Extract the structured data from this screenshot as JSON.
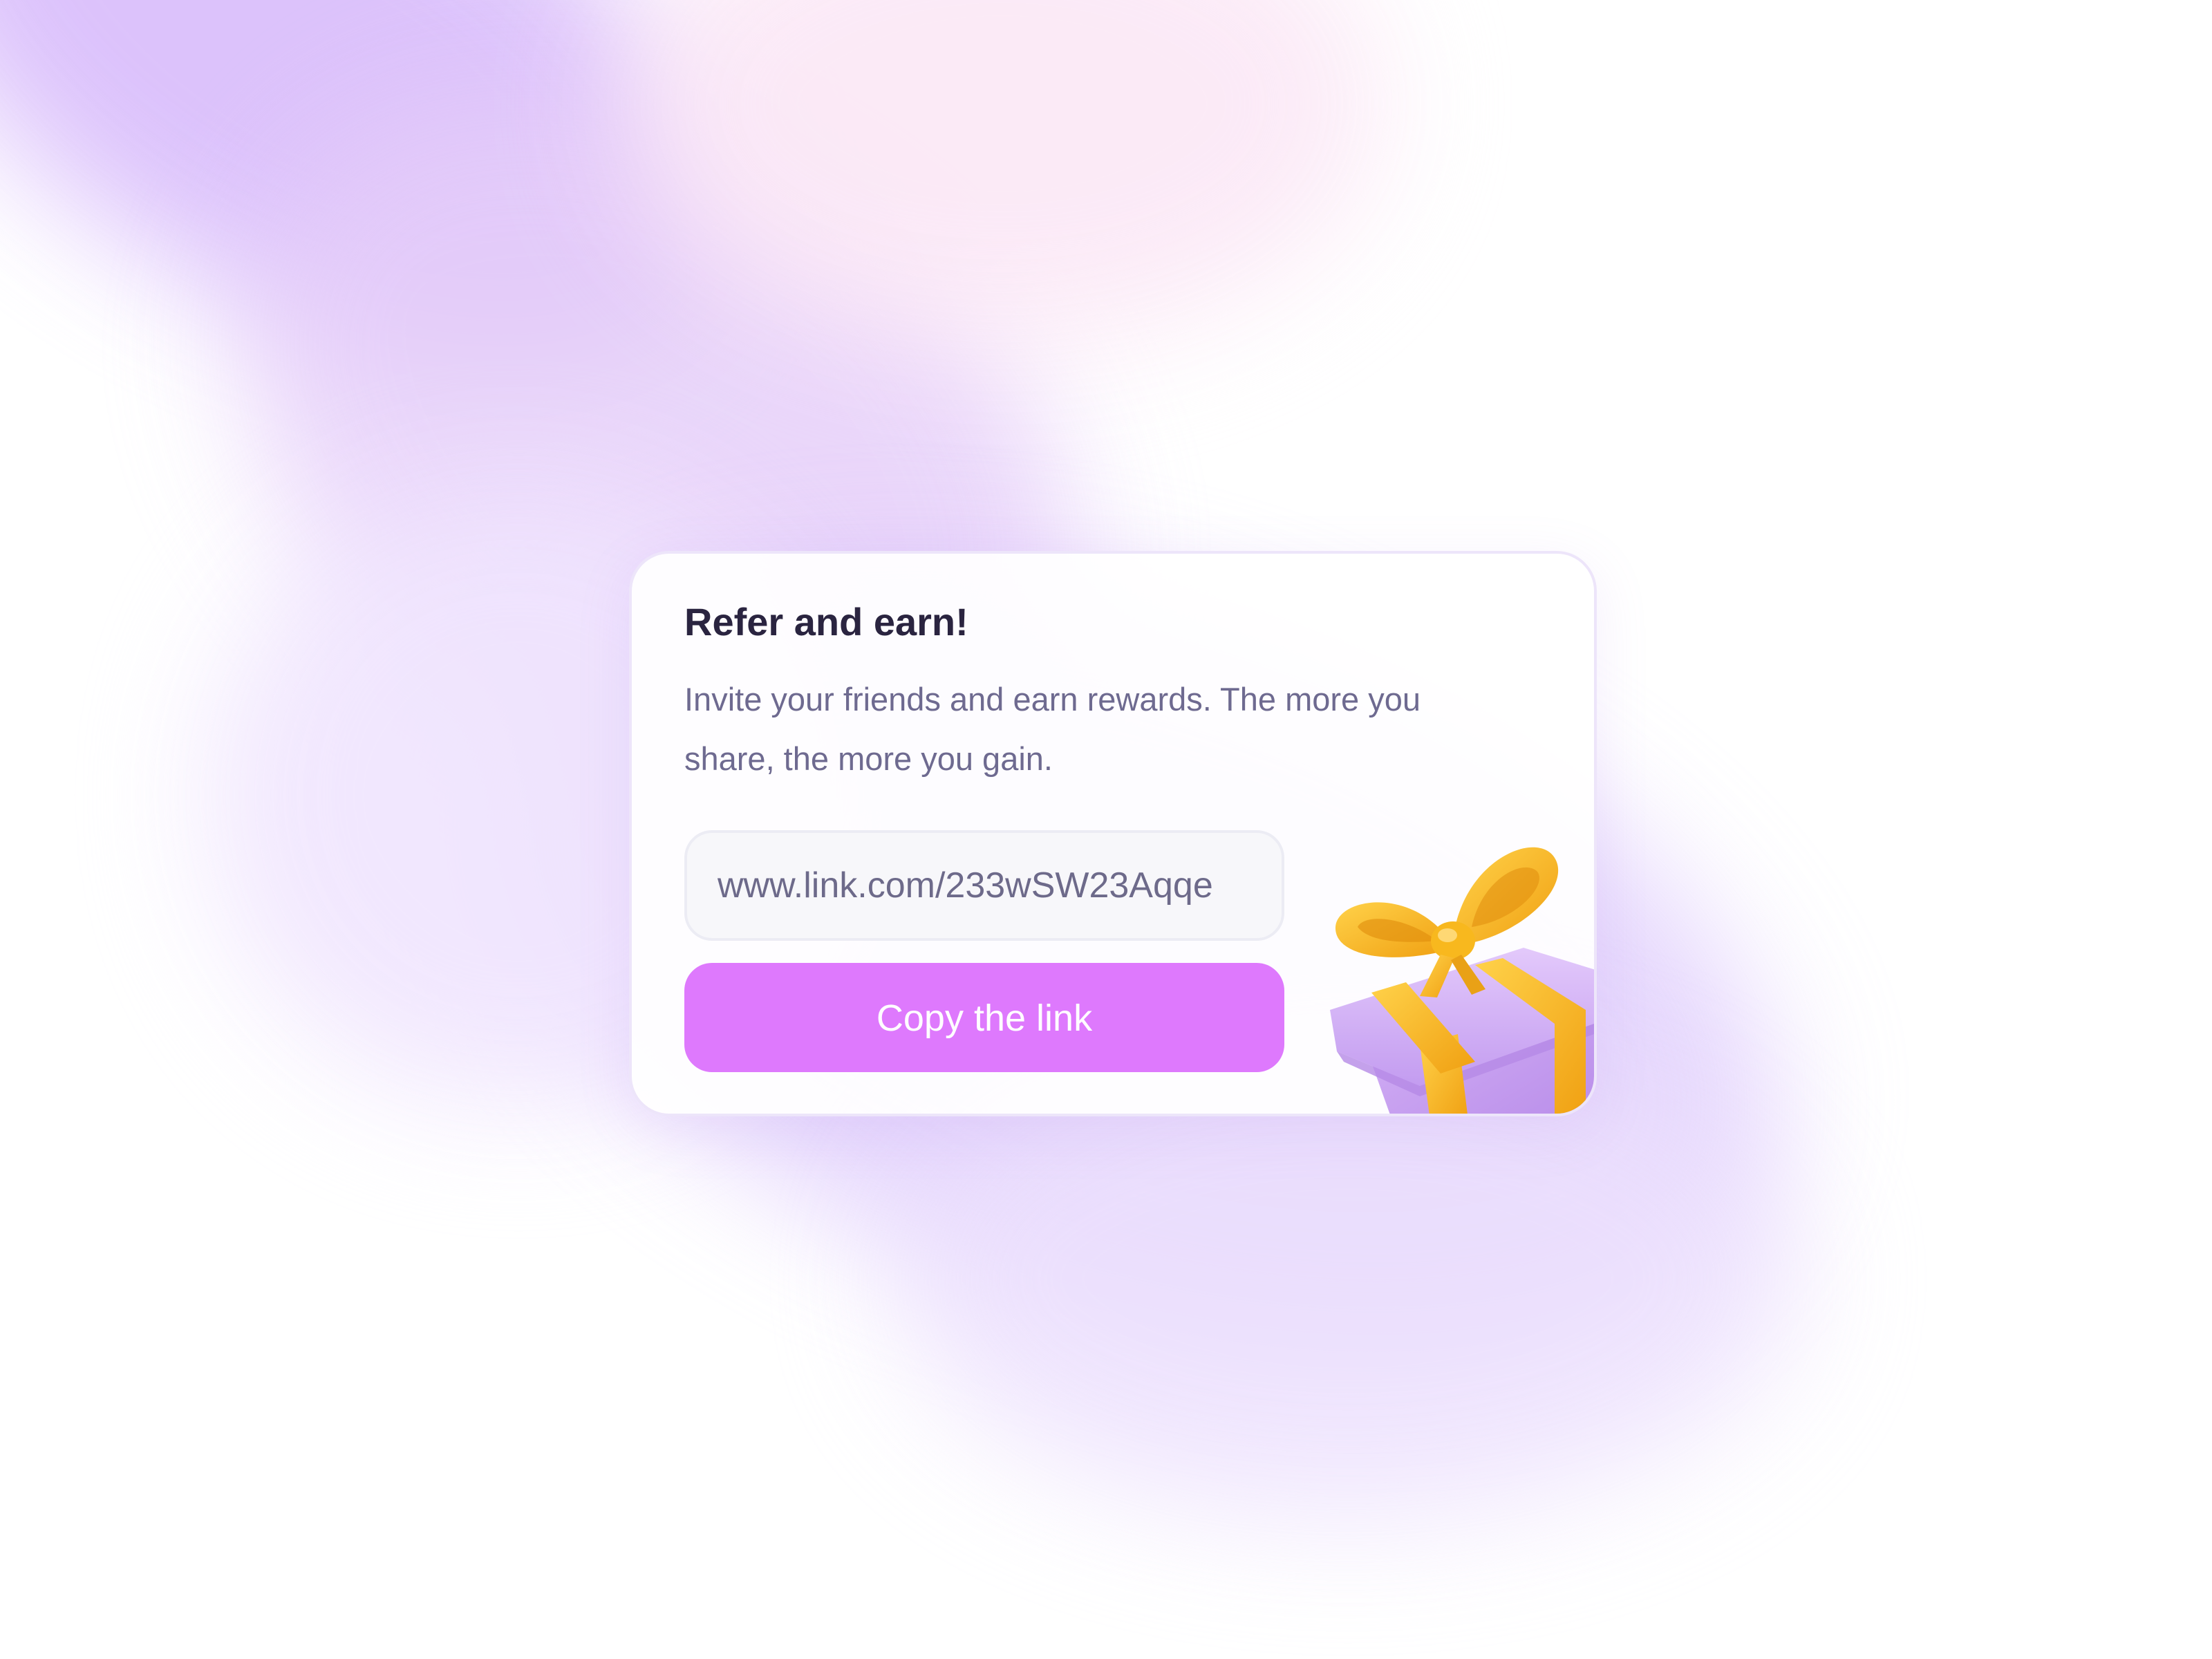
{
  "card": {
    "title": "Refer and earn!",
    "description": "Invite your friends and earn rewards. The more you share, the more you gain.",
    "link_value": "www.link.com/233wSW23Aqqe",
    "copy_button_label": "Copy the link",
    "gift_icon": "gift-box-icon"
  },
  "colors": {
    "accent": "#de79fd",
    "title": "#2a2440",
    "body_text": "#6e6a90",
    "field_background": "#f7f7fa",
    "gift_box": "#c9a3f3",
    "gift_ribbon": "#f7b320"
  }
}
